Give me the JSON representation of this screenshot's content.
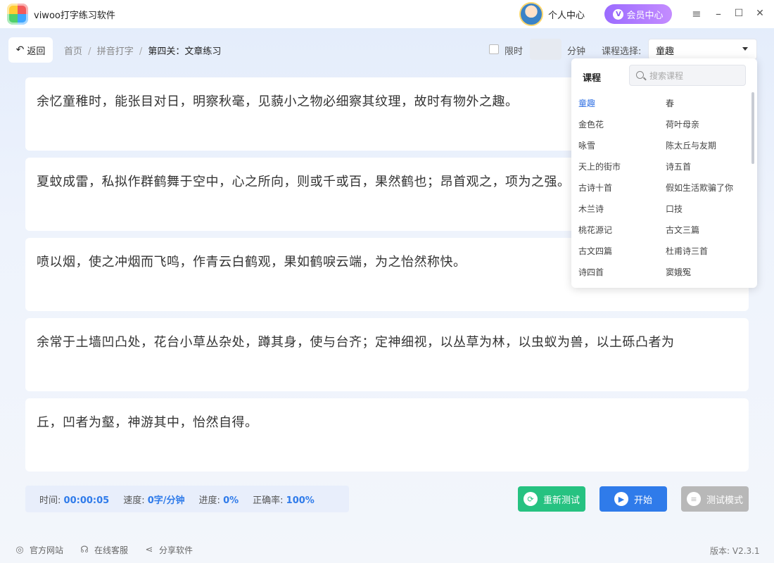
{
  "app": {
    "title": "viwoo打字练习软件",
    "user_center": "个人中心",
    "vip_center": "会员中心",
    "vip_badge": "V"
  },
  "window_controls": {
    "menu": "≡",
    "minimize": "–",
    "maximize": "☐",
    "close": "✕"
  },
  "nav": {
    "back_label": "返回",
    "breadcrumb": [
      "首页",
      "拼音打字",
      "第四关：文章练习"
    ],
    "breadcrumb_separator": "/",
    "time_limit_label": "限时",
    "minutes_value": "",
    "minutes_label": "分钟",
    "course_select_label": "课程选择:",
    "course_selected": "童趣"
  },
  "text_lines": [
    "余忆童稚时，能张目对日，明察秋毫，见藐小之物必细察其纹理，故时有物外之趣。",
    "夏蚊成雷，私拟作群鹤舞于空中，心之所向，则或千或百，果然鹤也；昂首观之，项为之强。",
    "喷以烟，使之冲烟而飞鸣，作青云白鹤观，果如鹤唳云端，为之怡然称快。",
    "余常于土墙凹凸处，花台小草丛杂处，蹲其身，使与台齐；定神细视，以丛草为林，以虫蚁为兽，以土砾凸者为",
    "丘，凹者为壑，神游其中，怡然自得。"
  ],
  "dropdown": {
    "title": "课程",
    "search_placeholder": "搜索课程",
    "items": [
      {
        "label": "童趣",
        "selected": true
      },
      {
        "label": "春",
        "selected": false
      },
      {
        "label": "金色花",
        "selected": false
      },
      {
        "label": "荷叶母亲",
        "selected": false
      },
      {
        "label": "咏雪",
        "selected": false
      },
      {
        "label": "陈太丘与友期",
        "selected": false
      },
      {
        "label": "天上的街市",
        "selected": false
      },
      {
        "label": "诗五首",
        "selected": false
      },
      {
        "label": "古诗十首",
        "selected": false
      },
      {
        "label": "假如生活欺骗了你",
        "selected": false
      },
      {
        "label": "木兰诗",
        "selected": false
      },
      {
        "label": "口技",
        "selected": false
      },
      {
        "label": "桃花源记",
        "selected": false
      },
      {
        "label": "古文三篇",
        "selected": false
      },
      {
        "label": "古文四篇",
        "selected": false
      },
      {
        "label": "杜甫诗三首",
        "selected": false
      },
      {
        "label": "诗四首",
        "selected": false
      },
      {
        "label": "窦娥冤",
        "selected": false
      }
    ]
  },
  "stats": {
    "time_label": "时间:",
    "time_value": "00:00:05",
    "speed_label": "速度:",
    "speed_value": "0字/分钟",
    "progress_label": "进度:",
    "progress_value": "0%",
    "accuracy_label": "正确率:",
    "accuracy_value": "100%"
  },
  "actions": {
    "retest_label": "重新测试",
    "start_label": "开始",
    "test_mode_label": "测试模式"
  },
  "colors": {
    "retest": "#26c281",
    "start": "#2f7bea",
    "test_mode": "#b8b8b8",
    "accent": "#2f6fe3",
    "vip": "#9b6bff"
  },
  "footer": {
    "website": "官方网站",
    "support": "在线客服",
    "share": "分享软件",
    "version": "版本: V2.3.1"
  }
}
